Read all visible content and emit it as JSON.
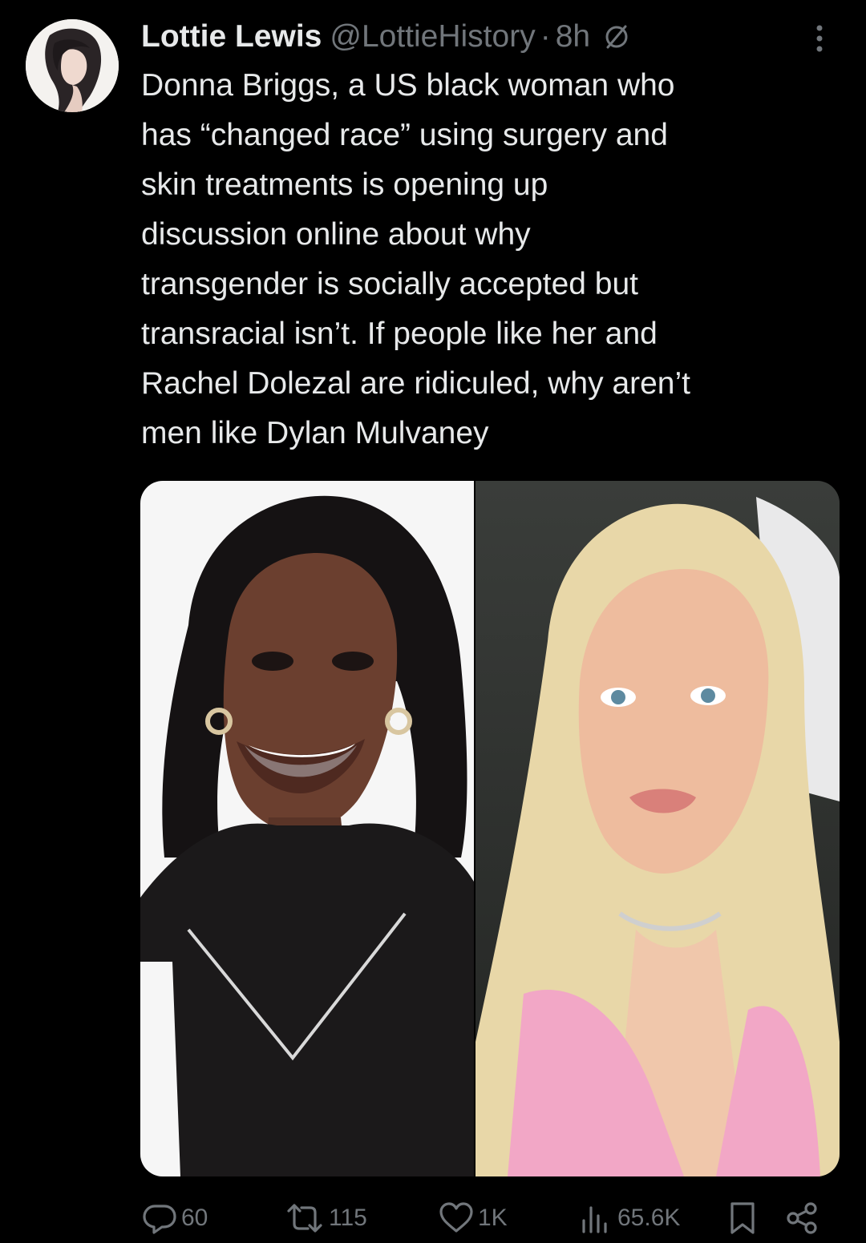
{
  "tweet": {
    "author": {
      "display_name": "Lottie Lewis",
      "handle": "@LottieHistory",
      "separator": "·",
      "time": "8h"
    },
    "text": "Donna Briggs, a US black woman who\nhas “changed race” using surgery and\nskin treatments is opening up\ndiscussion online about why\ntransgender is socially accepted but\ntransracial isn’t. If people like her and\nRachel Dolezal are ridiculed, why aren’t\nmen like Dylan Mulvaney",
    "media": {
      "left_image": "portrait-photo-before",
      "right_image": "portrait-photo-after"
    },
    "actions": {
      "replies": "60",
      "reposts": "115",
      "likes": "1K",
      "views": "65.6K"
    }
  },
  "icons": {
    "avatar": "avatar-illustration",
    "badge": "community-note-icon",
    "more": "more-options-icon",
    "reply": "reply-icon",
    "repost": "repost-icon",
    "like": "like-icon",
    "views": "views-icon",
    "bookmark": "bookmark-icon",
    "share": "share-icon"
  },
  "colors": {
    "background": "#000000",
    "primary_text": "#e7e9ea",
    "secondary_text": "#71767b"
  }
}
